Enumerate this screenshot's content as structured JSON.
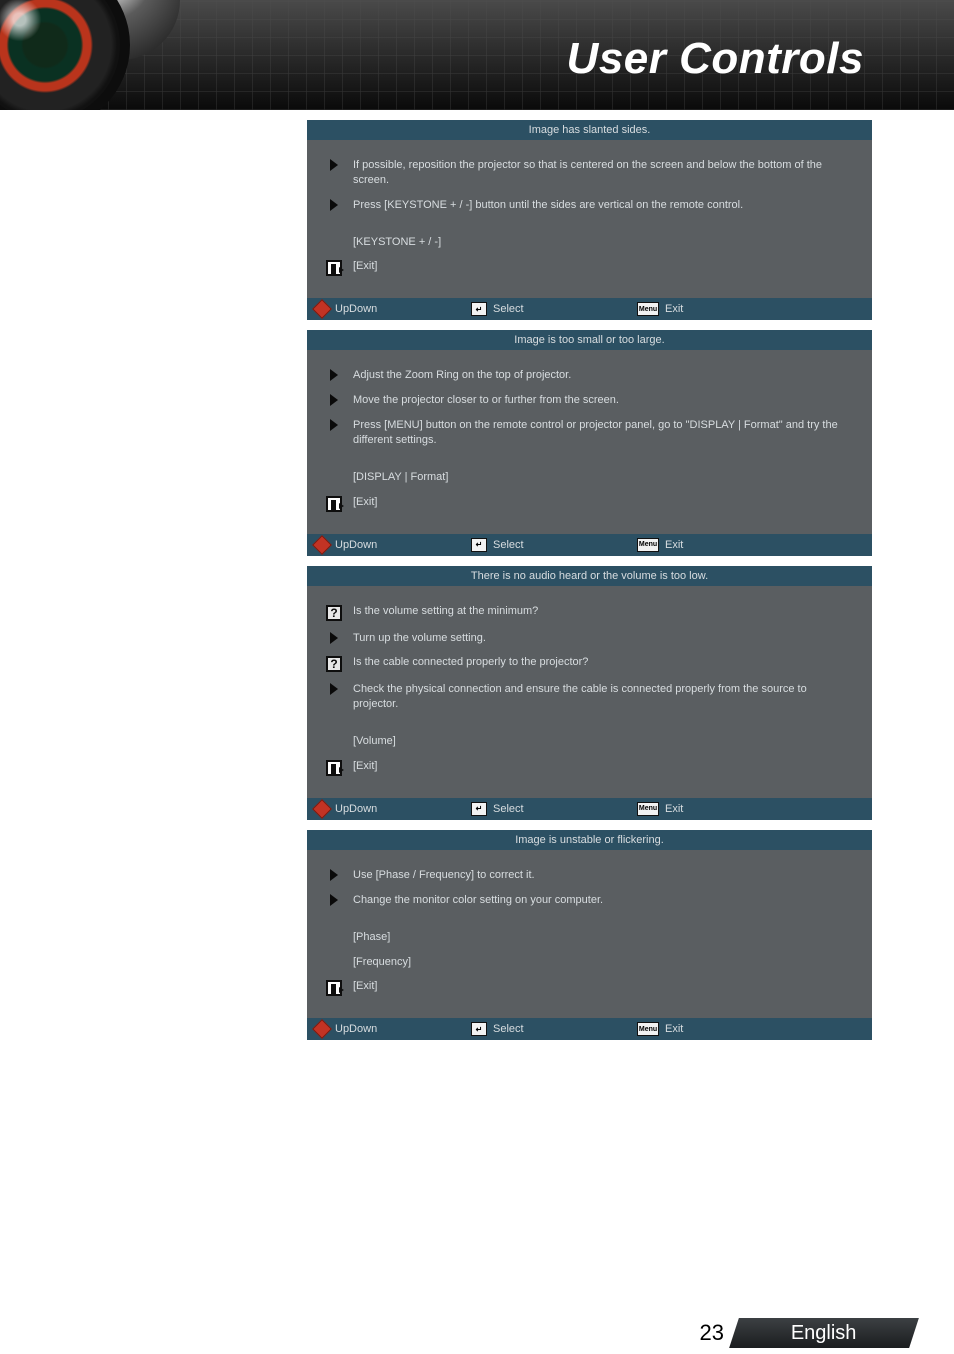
{
  "header": {
    "title": "User Controls"
  },
  "footer": {
    "page": "23",
    "language": "English"
  },
  "footer_bar": {
    "updown": "UpDown",
    "select": "Select",
    "exit": "Exit",
    "menu_icon_text": "Menu",
    "enter_icon_text": "↵"
  },
  "panels": [
    {
      "title": "Image has slanted sides.",
      "items": [
        {
          "icon": "arrow",
          "text": "If possible, reposition the projector so that is centered on the screen and below the bottom of the screen."
        },
        {
          "icon": "arrow",
          "text": "Press [KEYSTONE + / -] button until the sides are vertical on the remote control."
        }
      ],
      "refs": [
        {
          "icon": "none",
          "text": "[KEYSTONE + / -]"
        },
        {
          "icon": "exit",
          "text": "[Exit]"
        }
      ]
    },
    {
      "title": "Image is too small or too large.",
      "items": [
        {
          "icon": "arrow",
          "text": "Adjust the Zoom Ring on the top of projector."
        },
        {
          "icon": "arrow",
          "text": "Move the projector closer to or further from the screen."
        },
        {
          "icon": "arrow",
          "text": "Press [MENU] button on the remote control or projector panel, go to \"DISPLAY | Format\" and try the different settings."
        }
      ],
      "refs": [
        {
          "icon": "none",
          "text": "[DISPLAY | Format]"
        },
        {
          "icon": "exit",
          "text": "[Exit]"
        }
      ]
    },
    {
      "title": "There is no audio heard or the volume is too low.",
      "items": [
        {
          "icon": "question",
          "text": "Is the volume setting at the minimum?"
        },
        {
          "icon": "arrow",
          "text": "Turn up the volume setting."
        },
        {
          "icon": "question",
          "text": "Is the cable connected properly to the projector?"
        },
        {
          "icon": "arrow",
          "text": "Check the physical connection and ensure the cable is connected properly from the source to projector."
        }
      ],
      "refs": [
        {
          "icon": "none",
          "text": "[Volume]"
        },
        {
          "icon": "exit",
          "text": "[Exit]"
        }
      ]
    },
    {
      "title": "Image is unstable or flickering.",
      "items": [
        {
          "icon": "arrow",
          "text": "Use [Phase / Frequency] to correct it."
        },
        {
          "icon": "arrow",
          "text": "Change the monitor color setting on your computer."
        }
      ],
      "refs": [
        {
          "icon": "none",
          "text": "[Phase]"
        },
        {
          "icon": "none",
          "text": "[Frequency]"
        },
        {
          "icon": "exit",
          "text": "[Exit]"
        }
      ]
    }
  ]
}
